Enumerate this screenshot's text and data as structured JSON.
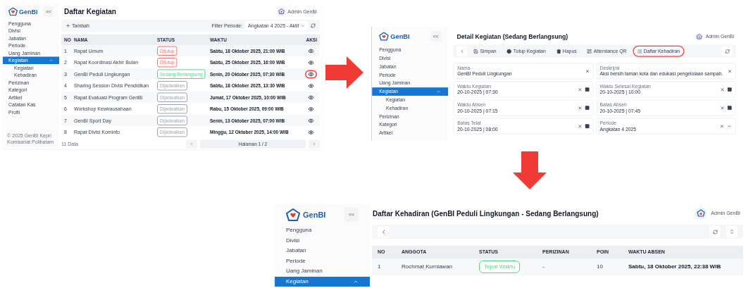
{
  "list_view": {
    "sidebar": {
      "logo": "GenBI",
      "collapse": "<<",
      "items": [
        {
          "label": "Pengguna",
          "selected": false
        },
        {
          "label": "Divisi",
          "selected": false
        },
        {
          "label": "Jabatan",
          "selected": false
        },
        {
          "label": "Periode",
          "selected": false
        },
        {
          "label": "Uang Jaminan",
          "selected": false
        },
        {
          "label": "Kegiatan",
          "selected": true,
          "expanded": true,
          "children": [
            {
              "label": "Kegiatan",
              "selected": false
            },
            {
              "label": "Kehadiran",
              "selected": false
            }
          ]
        },
        {
          "label": "Perizinan",
          "selected": false
        },
        {
          "label": "Kategori",
          "selected": false
        },
        {
          "label": "Artikel",
          "selected": false
        },
        {
          "label": "Catatan Kas",
          "selected": false
        },
        {
          "label": "Profil",
          "selected": false
        }
      ],
      "footer": "© 2025 GenBI Kepri Komisariat Polibatam"
    },
    "title": "Daftar Kegiatan",
    "user": "Admin GenBI",
    "add_button": "Tambah",
    "filter_label": "Filter Periode:",
    "filter_value": "Angkatan 4 2025 - Aktif",
    "table": {
      "columns": [
        "NO",
        "NAMA",
        "STATUS",
        "WAKTU",
        "AKSI"
      ],
      "rows": [
        {
          "no": "1",
          "name": "Rapat Umum",
          "status": {
            "text": "Ditutup",
            "color": "#f87171"
          },
          "time": "Sabtu, 18 Oktober 2025, 21:00 WIB",
          "circled": false
        },
        {
          "no": "2",
          "name": "Rapat Koordinasi Akhir Bulan",
          "status": {
            "text": "Ditutup",
            "color": "#f87171"
          },
          "time": "Sabtu, 25 Oktober 2025, 16:00 WIB",
          "circled": false
        },
        {
          "no": "3",
          "name": "GenBI Peduli Lingkungan",
          "status": {
            "text": "Sedang Berlangsung",
            "color": "#4ade80"
          },
          "time": "Senin, 20 Oktober 2025, 07:30 WIB",
          "circled": true
        },
        {
          "no": "4",
          "name": "Sharing Session Divisi Pendidikan",
          "status": {
            "text": "Dijadwalkan",
            "color": "#9ca3af"
          },
          "time": "Sabtu, 18 Oktober 2025, 13:30 WIB",
          "circled": false
        },
        {
          "no": "5",
          "name": "Rapat Evaluasi Program GenBI",
          "status": {
            "text": "Dijadwalkan",
            "color": "#9ca3af"
          },
          "time": "Jumat, 17 Oktober 2025, 10:00 WIB",
          "circled": false
        },
        {
          "no": "6",
          "name": "Workshop Kewirausahaan",
          "status": {
            "text": "Dijadwalkan",
            "color": "#9ca3af"
          },
          "time": "Rabu, 15 Oktober 2025, 09:00 WIB",
          "circled": false
        },
        {
          "no": "7",
          "name": "GenBI Sport Day",
          "status": {
            "text": "Dijadwalkan",
            "color": "#9ca3af"
          },
          "time": "Senin, 13 Oktober 2025, 07:00 WIB",
          "circled": false
        },
        {
          "no": "8",
          "name": "Rapat Divisi Kominfo",
          "status": {
            "text": "Dijadwalkan",
            "color": "#9ca3af"
          },
          "time": "Minggu, 12 Oktober 2025, 14:00 WIB",
          "circled": false
        }
      ]
    },
    "count": "11 Data",
    "page": "Halaman 1 / 2"
  },
  "detail_view": {
    "sidebar": {
      "logo": "GenBI",
      "collapse": "<<",
      "items": [
        {
          "label": "Pengguna",
          "selected": false
        },
        {
          "label": "Divisi",
          "selected": false
        },
        {
          "label": "Jabatan",
          "selected": false
        },
        {
          "label": "Periode",
          "selected": false
        },
        {
          "label": "Uang Jaminan",
          "selected": false
        },
        {
          "label": "Kegiatan",
          "selected": true,
          "expanded": true,
          "children": [
            {
              "label": "Kegiatan",
              "selected": false
            },
            {
              "label": "Kehadiran",
              "selected": false
            }
          ]
        },
        {
          "label": "Perizinan",
          "selected": false
        },
        {
          "label": "Kategori",
          "selected": false
        },
        {
          "label": "Artikel",
          "selected": false
        }
      ]
    },
    "title": "Detail Kegiatan (Sedang Berlangsung)",
    "user": "Admin GenBI",
    "toolbar": [
      {
        "kind": "save",
        "label": "Simpan",
        "circled": false
      },
      {
        "kind": "close",
        "label": "Tutup Kegiatan",
        "circled": false
      },
      {
        "kind": "delete",
        "label": "Hapus",
        "circled": false
      },
      {
        "kind": "qr",
        "label": "Attendance QR",
        "circled": false
      },
      {
        "kind": "list",
        "label": "Daftar Kehadiran",
        "circled": true
      }
    ],
    "fields": [
      {
        "kind": "text",
        "label": "Nama",
        "value": "GenBI Peduli Lingkungan"
      },
      {
        "kind": "text",
        "label": "Deskripsi",
        "value": "Aksi bersih taman kota dan edukasi pengelolaan sampah."
      },
      {
        "kind": "date",
        "label": "Waktu Kegiatan",
        "value": "20-10-2025 | 07:30"
      },
      {
        "kind": "date",
        "label": "Waktu Selesai Kegiatan",
        "value": "20-10-2025 | 10:00"
      },
      {
        "kind": "date",
        "label": "Waktu Absen",
        "value": "20-10-2025 | 07:15"
      },
      {
        "kind": "date",
        "label": "Batas Absen",
        "value": "20-10-2025 | 07:45"
      },
      {
        "kind": "date",
        "label": "Batas Telat",
        "value": "20-10-2025 | 08:00"
      },
      {
        "kind": "select",
        "label": "Periode",
        "value": "Angkatan 4 2025"
      }
    ]
  },
  "attendance_view": {
    "sidebar": {
      "logo": "GenBI",
      "collapse": "<<",
      "items": [
        {
          "label": "Pengguna",
          "selected": false
        },
        {
          "label": "Divisi",
          "selected": false
        },
        {
          "label": "Jabatan",
          "selected": false
        },
        {
          "label": "Periode",
          "selected": false
        },
        {
          "label": "Uang Jaminan",
          "selected": false
        },
        {
          "label": "Kegiatan",
          "selected": true,
          "expanded": true
        }
      ]
    },
    "title": "Daftar Kehadiran (GenBI Peduli Lingkungan - Sedang Berlangsung)",
    "user": "Admin GenBI",
    "table": {
      "columns": [
        "NO",
        "ANGGOTA",
        "STATUS",
        "PERIZINAN",
        "POIN",
        "WAKTU ABSEN"
      ],
      "rows": [
        {
          "no": "1",
          "member": "Rochmat Kurniawan",
          "status": {
            "text": "Tepat Waktu",
            "color": "#4ade80"
          },
          "permit": "-",
          "points": "10",
          "time": "Sabtu, 18 Oktober 2025, 22:38 WIB"
        }
      ]
    }
  }
}
